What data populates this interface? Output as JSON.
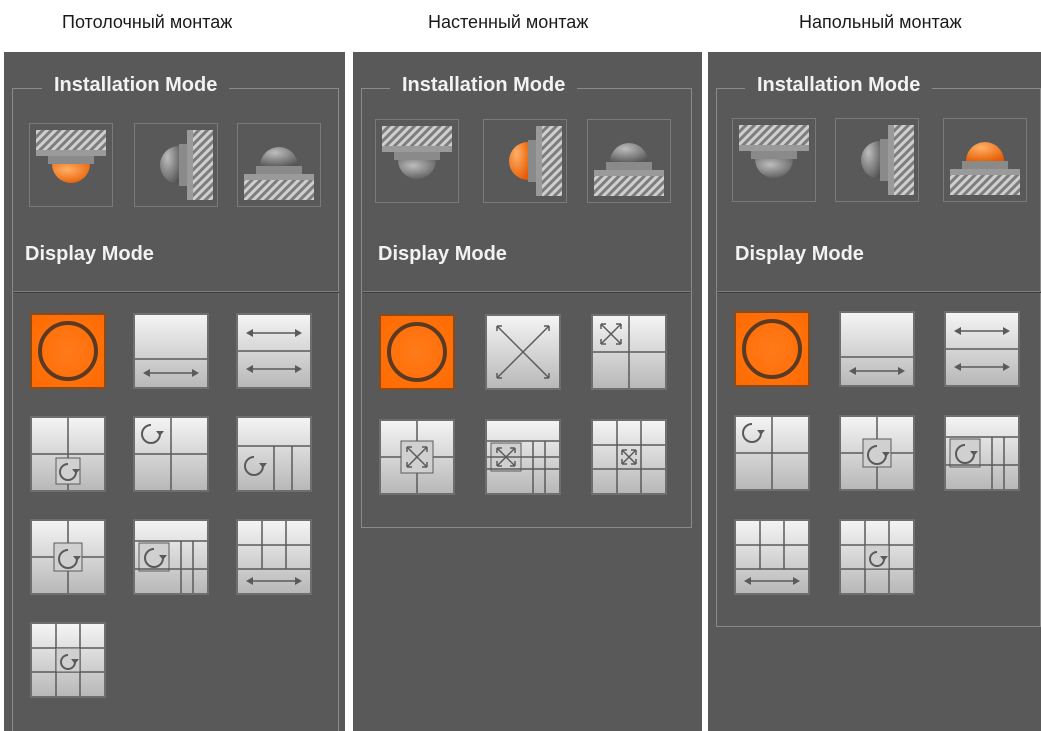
{
  "captions": [
    "Потолочный монтаж",
    "Настенный монтаж",
    "Напольный монтаж"
  ],
  "panels": [
    {
      "installation_mode_label": "Installation Mode",
      "display_mode_label": "Display Mode",
      "selected_install": "ceiling",
      "display_buttons": [
        "fisheye-original",
        "panorama-180",
        "dual-panorama",
        "original-plus-ptz",
        "original-plus-3-ptz",
        "original-plus-2-ptz",
        "original-plus-4-ptz",
        "panorama-plus-ptz",
        "panorama-plus-6-ptz",
        "original-plus-8-ptz"
      ],
      "selected_display": "fisheye-original"
    },
    {
      "installation_mode_label": "Installation Mode",
      "display_mode_label": "Display Mode",
      "selected_install": "wall",
      "display_buttons": [
        "fisheye-original",
        "panorama-expand",
        "original-plus-3-expand",
        "original-plus-4-expand",
        "panorama-plus-6-expand",
        "original-plus-8-expand"
      ],
      "selected_display": "fisheye-original"
    },
    {
      "installation_mode_label": "Installation Mode",
      "display_mode_label": "Display Mode",
      "selected_install": "floor",
      "display_buttons": [
        "fisheye-original",
        "panorama-180",
        "dual-panorama",
        "original-plus-3-ptz",
        "original-plus-4-ptz",
        "panorama-plus-ptz",
        "panorama-plus-6-ptz",
        "original-plus-8-ptz"
      ],
      "selected_display": "fisheye-original"
    }
  ],
  "colors": {
    "accent": "#ff7a1a",
    "panel_bg": "#595959",
    "button_face": "#d6d6d6"
  }
}
